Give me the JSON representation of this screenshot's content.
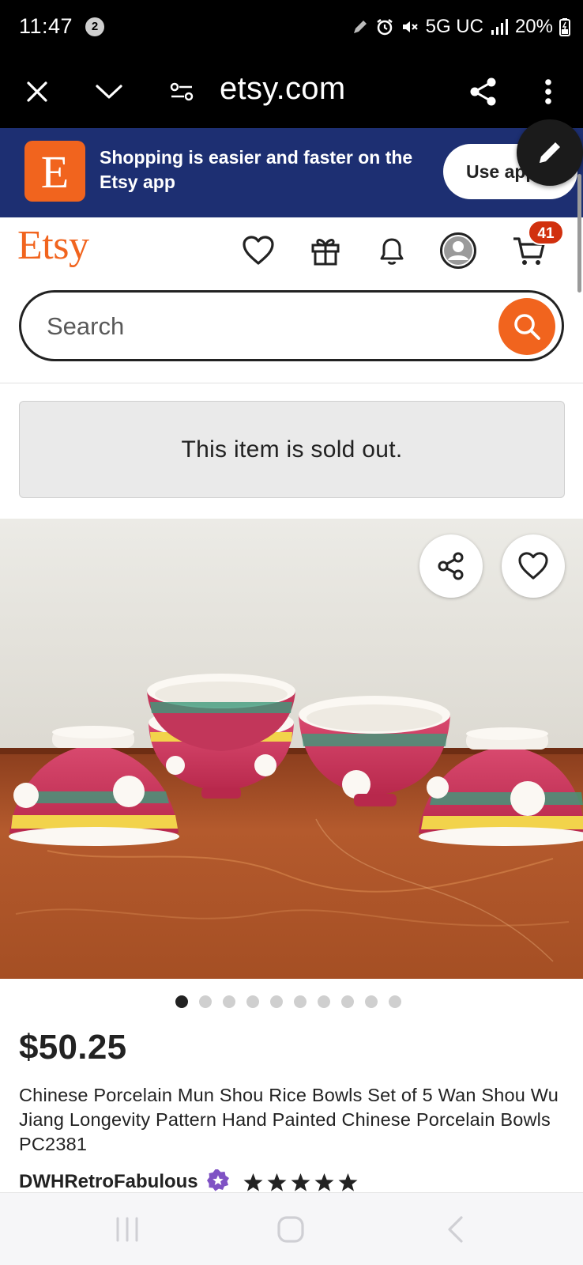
{
  "status_bar": {
    "time": "11:47",
    "notification_count": "2",
    "network": "5G UC",
    "battery": "20%"
  },
  "browser": {
    "url": "etsy.com"
  },
  "app_banner": {
    "logo_letter": "E",
    "message": "Shopping is easier and faster on the Etsy app",
    "button_label": "Use app"
  },
  "header": {
    "logo": "Etsy",
    "cart_count": "41",
    "search_placeholder": "Search"
  },
  "notice": {
    "sold_out": "This item is sold out."
  },
  "gallery": {
    "image_count": 10,
    "active_index": 0
  },
  "product": {
    "price": "$50.25",
    "title": "Chinese Porcelain Mun Shou Rice Bowls Set of 5 Wan Shou Wu Jiang Longevity Pattern Hand Painted Chinese Porcelain Bowls PC2381",
    "shop_name": "DWHRetroFabulous",
    "rating_stars": 5
  },
  "colors": {
    "brand_orange": "#f1641e",
    "banner_navy": "#1d2f72",
    "cart_badge": "#d1300e",
    "star_seller_purple": "#7f52c4"
  }
}
